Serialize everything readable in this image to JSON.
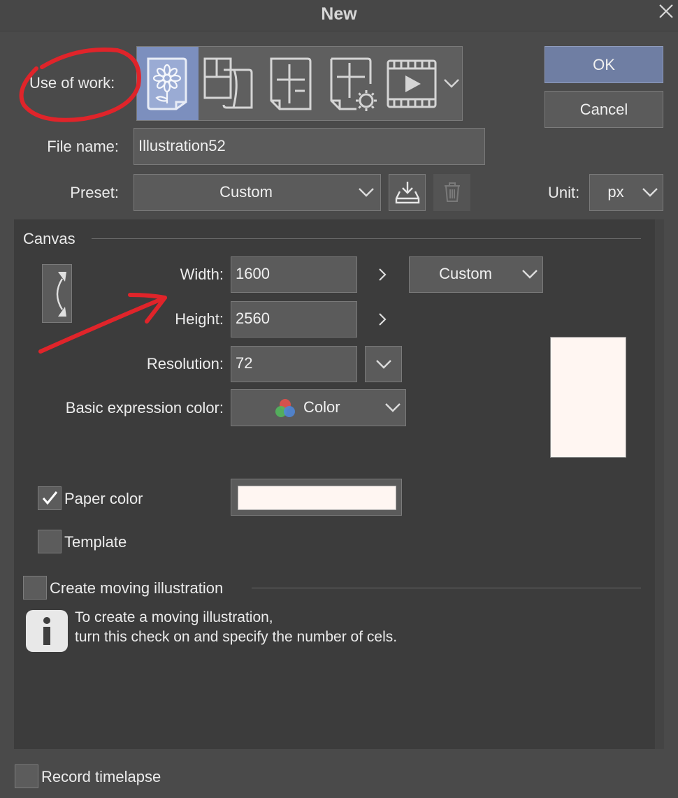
{
  "dialog": {
    "title": "New"
  },
  "buttons": {
    "ok": "OK",
    "cancel": "Cancel"
  },
  "use_of_work": {
    "label": "Use of work:",
    "options": [
      {
        "icon": "illustration-icon",
        "selected": true
      },
      {
        "icon": "comic-icon",
        "selected": false
      },
      {
        "icon": "comic-pages-icon",
        "selected": false
      },
      {
        "icon": "comic-settings-icon",
        "selected": false
      },
      {
        "icon": "animation-icon",
        "selected": false
      }
    ]
  },
  "file_name": {
    "label": "File name:",
    "value": "Illustration52"
  },
  "preset": {
    "label": "Preset:",
    "value": "Custom"
  },
  "unit": {
    "label": "Unit:",
    "value": "px"
  },
  "canvas": {
    "section_label": "Canvas",
    "width": {
      "label": "Width:",
      "value": "1600"
    },
    "height": {
      "label": "Height:",
      "value": "2560"
    },
    "size_preset": "Custom",
    "resolution": {
      "label": "Resolution:",
      "value": "72"
    },
    "expression_color": {
      "label": "Basic expression color:",
      "value": "Color"
    },
    "paper_color": {
      "label": "Paper color",
      "checked": true,
      "color": "#fff6f2"
    },
    "template": {
      "label": "Template",
      "checked": false
    }
  },
  "moving_illustration": {
    "label": "Create moving illustration",
    "checked": false,
    "info_line1": "To create a moving illustration,",
    "info_line2": "turn this check on and specify the number of cels."
  },
  "timelapse": {
    "label": "Record timelapse",
    "checked": false
  },
  "colors": {
    "accent": "#7c8fbe",
    "ok_button": "#6f7ea3",
    "annotation": "#e0242a"
  }
}
